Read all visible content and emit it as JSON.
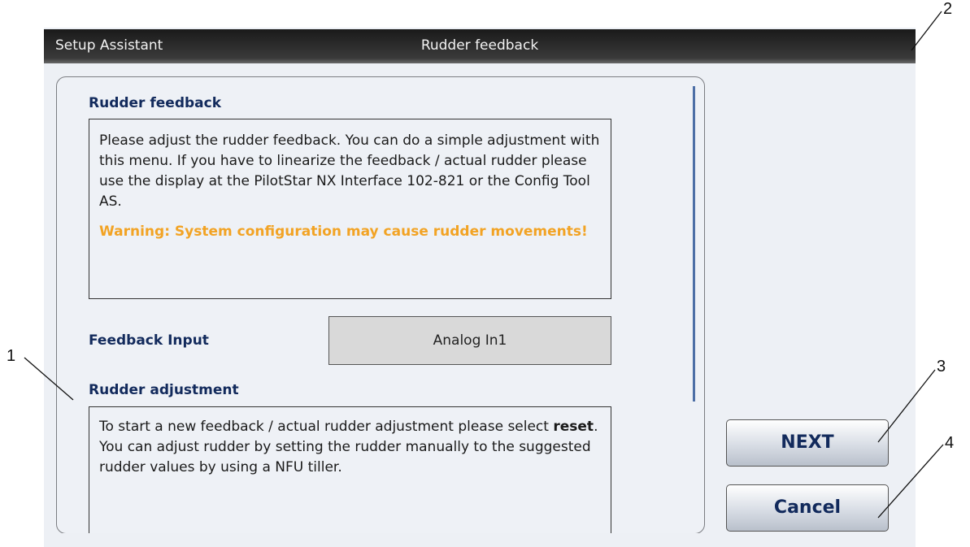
{
  "titlebar": {
    "app": "Setup Assistant",
    "title": "Rudder feedback"
  },
  "section1": {
    "title": "Rudder feedback",
    "text": "Please adjust the rudder feedback. You can do a simple adjustment with this menu. If you have to linearize the feedback / actual rudder please use the display at the PilotStar NX Interface 102-821 or the Config Tool AS.",
    "warning": "Warning: System configuration may cause rudder movements!"
  },
  "feedback_input": {
    "label": "Feedback Input",
    "value": "Analog In1"
  },
  "section2": {
    "title": "Rudder adjustment",
    "text_before": "To start a new feedback / actual rudder adjustment please select ",
    "bold": "reset",
    "text_after": ". You can adjust rudder by setting the rudder manually to the suggested rudder values by using a NFU tiller."
  },
  "buttons": {
    "next": "NEXT",
    "cancel": "Cancel"
  },
  "callouts": {
    "c1": "1",
    "c2": "2",
    "c3": "3",
    "c4": "4"
  }
}
